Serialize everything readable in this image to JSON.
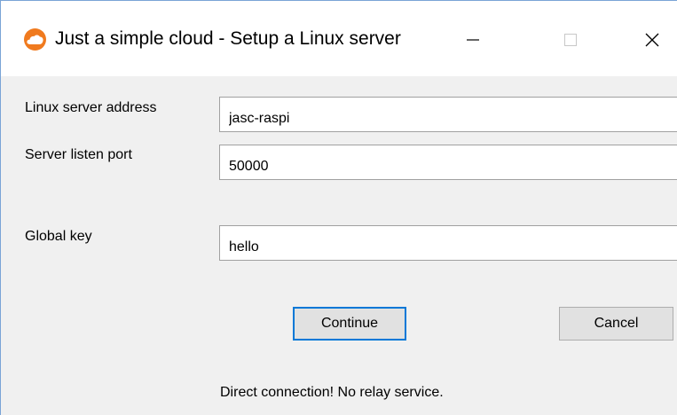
{
  "window": {
    "title": "Just a simple cloud - Setup a Linux server",
    "icon": "cloud-icon",
    "accent_color": "#f07a1e"
  },
  "form": {
    "address_label": "Linux server address",
    "address_value": "jasc-raspi",
    "port_label": "Server listen port",
    "port_value": "50000",
    "key_label": "Global key",
    "key_value": "hello"
  },
  "buttons": {
    "continue_label": "Continue",
    "cancel_label": "Cancel"
  },
  "status": {
    "message": "Direct connection! No relay service."
  }
}
